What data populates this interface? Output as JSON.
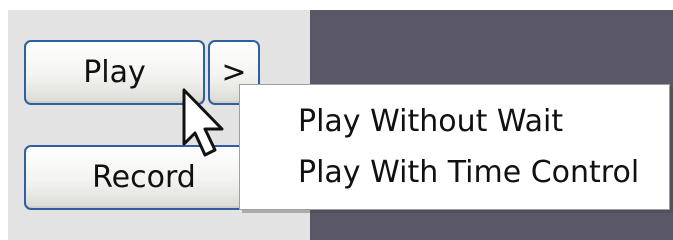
{
  "buttons": {
    "play_label": "Play",
    "record_label": "Record",
    "arrow_label": ">"
  },
  "menu": {
    "items": [
      {
        "label": "Play Without Wait"
      },
      {
        "label": "Play With Time Control"
      }
    ]
  },
  "cursor": {
    "icon": "arrow-cursor-icon"
  },
  "colors": {
    "panel_background": "#e3e3e3",
    "dark_panel": "#5a5866",
    "button_border": "#2f5f9e",
    "menu_background": "#ffffff"
  }
}
